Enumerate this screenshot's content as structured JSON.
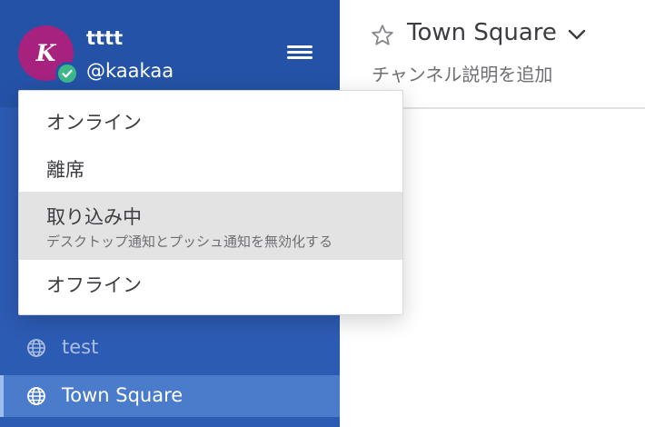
{
  "sidebar": {
    "avatar_initial": "K",
    "username": "tttt",
    "handle": "@kaakaa",
    "channels": [
      {
        "label": "test",
        "icon": "globe-icon",
        "state": "dim"
      },
      {
        "label": "Town Square",
        "icon": "globe-icon",
        "state": "active"
      }
    ]
  },
  "status_menu": {
    "items": [
      {
        "label": "オンライン"
      },
      {
        "label": "離席"
      },
      {
        "label": "取り込み中",
        "sublabel": "デスクトップ通知とプッシュ通知を無効化する",
        "highlighted": true
      },
      {
        "label": "オフライン"
      }
    ]
  },
  "channel_header": {
    "title": "Town Square",
    "description_placeholder": "チャンネル説明を追加"
  },
  "colors": {
    "sidebar_bg": "#2c5bb3",
    "sidebar_header_bg": "#2452a6",
    "avatar_bg": "#a7217e",
    "online_status": "#3db887",
    "active_channel_bg": "#4b7ccc"
  }
}
